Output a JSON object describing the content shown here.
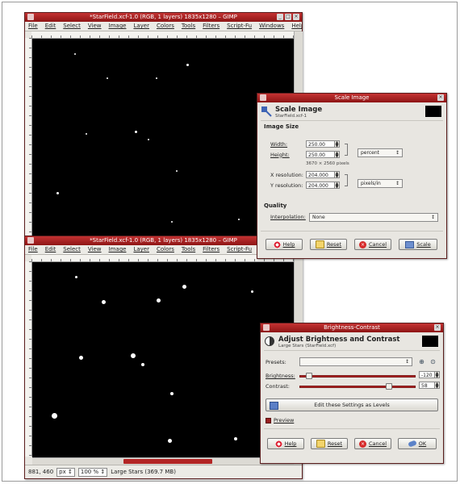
{
  "top_window": {
    "title": "*StarField.xcf-1.0 (RGB, 1 layers) 1835x1280 – GIMP",
    "menu": [
      "File",
      "Edit",
      "Select",
      "View",
      "Image",
      "Layer",
      "Colors",
      "Tools",
      "Filters",
      "Script-Fu",
      "Windows",
      "Help"
    ]
  },
  "bottom_window": {
    "title": "*StarField.xcf-1.0 (RGB, 1 layers) 1835x1280 – GIMP",
    "menu": [
      "File",
      "Edit",
      "Select",
      "View",
      "Image",
      "Layer",
      "Colors",
      "Tools",
      "Filters",
      "Script-Fu",
      "W"
    ],
    "status": {
      "coords": "881, 460",
      "unit": "px",
      "zoom": "100 %",
      "message": "Large Stars (369.7 MB)"
    }
  },
  "scale_dialog": {
    "title": "Scale Image",
    "heading": "Scale Image",
    "subheading": "StarField.xcf-1",
    "image_size_label": "Image Size",
    "width_label": "Width:",
    "width_value": "250.00",
    "height_label": "Height:",
    "height_value": "250.00",
    "unit": "percent",
    "pixels_note": "3670 × 2560 pixels",
    "xres_label": "X resolution:",
    "xres_value": "204.000",
    "yres_label": "Y resolution:",
    "yres_value": "204.000",
    "res_unit": "pixels/in",
    "quality_label": "Quality",
    "interp_label": "Interpolation:",
    "interp_value": "None",
    "buttons": {
      "help": "Help",
      "reset": "Reset",
      "cancel": "Cancel",
      "scale": "Scale"
    }
  },
  "bc_dialog": {
    "title": "Brightness-Contrast",
    "heading": "Adjust Brightness and Contrast",
    "subheading": "Large Stars (StarField.xcf)",
    "presets_label": "Presets:",
    "brightness_label": "Brightness:",
    "brightness_value": "-120",
    "brightness_level": 0.06,
    "contrast_label": "Contrast:",
    "contrast_value": "58",
    "contrast_level": 0.79,
    "levels_button": "Edit these Settings as Levels",
    "preview_label": "Preview",
    "buttons": {
      "help": "Help",
      "reset": "Reset",
      "cancel": "Cancel",
      "ok": "OK"
    }
  },
  "colors": {
    "titlebar": "#b02121",
    "canvas": "#000000",
    "slider": "#b32525"
  }
}
